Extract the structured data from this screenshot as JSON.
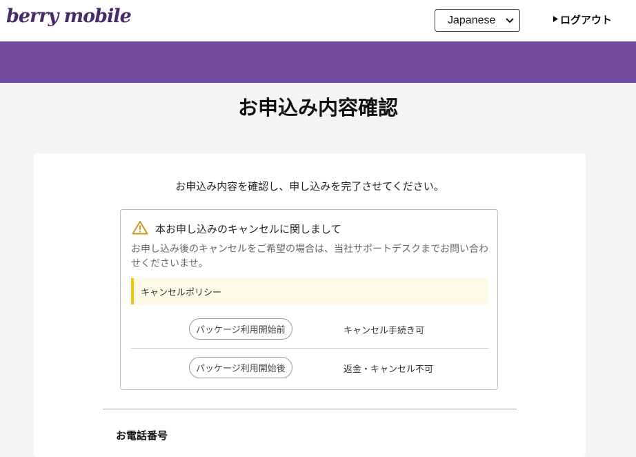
{
  "header": {
    "logo": "berry mobile",
    "language": {
      "selected": "Japanese"
    },
    "logout_label": "ログアウト"
  },
  "page_title": "お申込み内容確認",
  "main": {
    "intro": "お申込み内容を確認し、申し込みを完了させてください。",
    "notice": {
      "heading": "本お申し込みのキャンセルに関しまして",
      "body": "お申し込み後のキャンセルをご希望の場合は、当社サポートデスクまでお問い合わせくださいませ。",
      "policy_title": "キャンセルポリシー",
      "policies": [
        {
          "stage": "パッケージ利用開始前",
          "status": "キャンセル手続き可"
        },
        {
          "stage": "パッケージ利用開始後",
          "status": "返金・キャンセル不可"
        }
      ]
    },
    "phone_label": "お電話番号"
  },
  "colors": {
    "brand_purple": "#714c9f",
    "logo": "#4a2a6b",
    "policy_accent": "#f1c40f",
    "policy_bg": "#fdf9e6",
    "warning_icon": "#c99a1a"
  },
  "icons": {
    "warning": "warning-icon",
    "dropdown": "chevron-down-icon",
    "logout": "triangle-right-icon"
  }
}
